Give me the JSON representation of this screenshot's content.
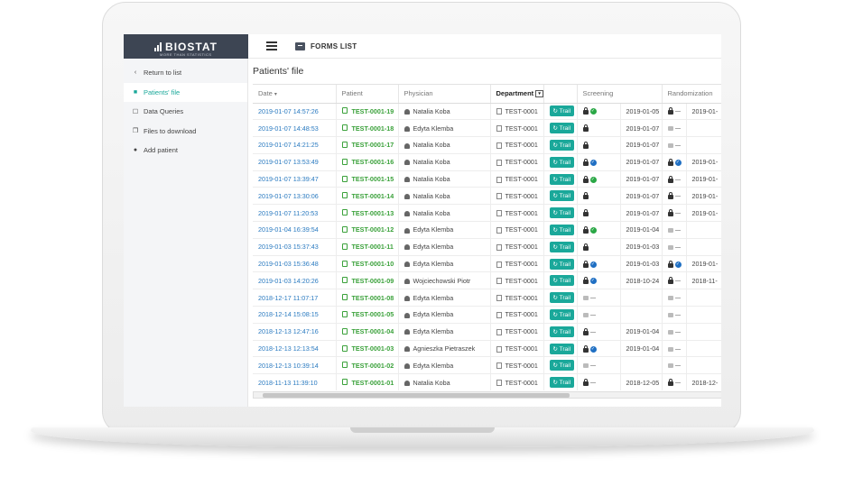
{
  "brand": {
    "name": "BIOSTAT",
    "tagline": "MORE THAN STATISTICS"
  },
  "topbar": {
    "forms_list_label": "FORMS LIST"
  },
  "sidebar": {
    "items": [
      {
        "label": "Return to list",
        "icon": "chevron-left-icon",
        "active": false
      },
      {
        "label": "Patients' file",
        "icon": "folder-icon",
        "active": true
      },
      {
        "label": "Data Queries",
        "icon": "chat-icon",
        "active": false
      },
      {
        "label": "Files to download",
        "icon": "files-icon",
        "active": false
      },
      {
        "label": "Add patient",
        "icon": "person-icon",
        "active": false
      }
    ]
  },
  "main": {
    "title": "Patients' file",
    "columns": [
      "Date",
      "Patient",
      "Physician",
      "Department",
      "",
      "Screening",
      "",
      "Randomization",
      ""
    ],
    "trail_label": "Trail",
    "rows": [
      {
        "date": "2019-01-07 14:57:26",
        "patient": "TEST-0001-19",
        "physician": "Natalia Koba",
        "dept": "TEST-0001",
        "scr": "lock-green",
        "scr_date": "2019-01-05",
        "rnd": "lock-dash",
        "rnd_date": "2019-01-"
      },
      {
        "date": "2019-01-07 14:48:53",
        "patient": "TEST-0001-18",
        "physician": "Edyta Klemba",
        "dept": "TEST-0001",
        "scr": "lock",
        "scr_date": "2019-01-07",
        "rnd": "unlock-dash",
        "rnd_date": ""
      },
      {
        "date": "2019-01-07 14:21:25",
        "patient": "TEST-0001-17",
        "physician": "Natalia Koba",
        "dept": "TEST-0001",
        "scr": "lock",
        "scr_date": "2019-01-07",
        "rnd": "unlock-dash",
        "rnd_date": ""
      },
      {
        "date": "2019-01-07 13:53:49",
        "patient": "TEST-0001-16",
        "physician": "Natalia Koba",
        "dept": "TEST-0001",
        "scr": "lock-blue",
        "scr_date": "2019-01-07",
        "rnd": "lock-blue",
        "rnd_date": "2019-01-"
      },
      {
        "date": "2019-01-07 13:39:47",
        "patient": "TEST-0001-15",
        "physician": "Natalia Koba",
        "dept": "TEST-0001",
        "scr": "lock-green",
        "scr_date": "2019-01-07",
        "rnd": "lock-dash",
        "rnd_date": "2019-01-"
      },
      {
        "date": "2019-01-07 13:30:06",
        "patient": "TEST-0001-14",
        "physician": "Natalia Koba",
        "dept": "TEST-0001",
        "scr": "lock",
        "scr_date": "2019-01-07",
        "rnd": "lock-dash",
        "rnd_date": "2019-01-"
      },
      {
        "date": "2019-01-07 11:20:53",
        "patient": "TEST-0001-13",
        "physician": "Natalia Koba",
        "dept": "TEST-0001",
        "scr": "lock",
        "scr_date": "2019-01-07",
        "rnd": "lock-dash",
        "rnd_date": "2019-01-"
      },
      {
        "date": "2019-01-04 16:39:54",
        "patient": "TEST-0001-12",
        "physician": "Edyta Klemba",
        "dept": "TEST-0001",
        "scr": "lock-green",
        "scr_date": "2019-01-04",
        "rnd": "unlock-dash",
        "rnd_date": ""
      },
      {
        "date": "2019-01-03 15:37:43",
        "patient": "TEST-0001-11",
        "physician": "Edyta Klemba",
        "dept": "TEST-0001",
        "scr": "lock",
        "scr_date": "2019-01-03",
        "rnd": "unlock-dash",
        "rnd_date": ""
      },
      {
        "date": "2019-01-03 15:36:48",
        "patient": "TEST-0001-10",
        "physician": "Edyta Klemba",
        "dept": "TEST-0001",
        "scr": "lock-blue",
        "scr_date": "2019-01-03",
        "rnd": "lock-blue",
        "rnd_date": "2019-01-"
      },
      {
        "date": "2019-01-03 14:20:26",
        "patient": "TEST-0001-09",
        "physician": "Wojciechowski Piotr",
        "dept": "TEST-0001",
        "scr": "lock-blue",
        "scr_date": "2018-10-24",
        "rnd": "lock-dash",
        "rnd_date": "2018-11-"
      },
      {
        "date": "2018-12-17 11:07:17",
        "patient": "TEST-0001-08",
        "physician": "Edyta Klemba",
        "dept": "TEST-0001",
        "scr": "unlock-dash",
        "scr_date": "",
        "rnd": "unlock-dash",
        "rnd_date": ""
      },
      {
        "date": "2018-12-14 15:08:15",
        "patient": "TEST-0001-05",
        "physician": "Edyta Klemba",
        "dept": "TEST-0001",
        "scr": "unlock-dash",
        "scr_date": "",
        "rnd": "unlock-dash",
        "rnd_date": ""
      },
      {
        "date": "2018-12-13 12:47:16",
        "patient": "TEST-0001-04",
        "physician": "Edyta Klemba",
        "dept": "TEST-0001",
        "scr": "lock-dash",
        "scr_date": "2019-01-04",
        "rnd": "unlock-dash",
        "rnd_date": ""
      },
      {
        "date": "2018-12-13 12:13:54",
        "patient": "TEST-0001-03",
        "physician": "Agnieszka Pietraszek",
        "dept": "TEST-0001",
        "scr": "lock-blue",
        "scr_date": "2019-01-04",
        "rnd": "unlock-dash",
        "rnd_date": ""
      },
      {
        "date": "2018-12-13 10:39:14",
        "patient": "TEST-0001-02",
        "physician": "Edyta Klemba",
        "dept": "TEST-0001",
        "scr": "unlock-dash",
        "scr_date": "",
        "rnd": "unlock-dash",
        "rnd_date": ""
      },
      {
        "date": "2018-11-13 11:39:10",
        "patient": "TEST-0001-01",
        "physician": "Natalia Koba",
        "dept": "TEST-0001",
        "scr": "lock-dash",
        "scr_date": "2018-12-05",
        "rnd": "lock-dash",
        "rnd_date": "2018-12-"
      }
    ]
  },
  "colors": {
    "accent": "#1aa89a",
    "brand_bg": "#3d4553",
    "link": "#2a7ac0",
    "patient_id": "#3aa13a"
  }
}
